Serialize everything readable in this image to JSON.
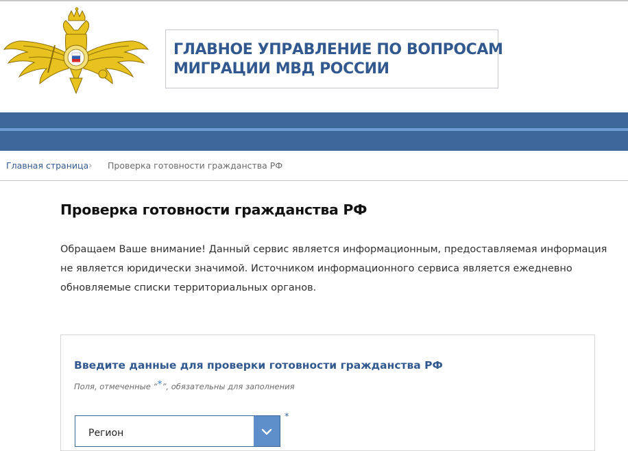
{
  "header": {
    "agency_title_line1": "ГЛАВНОЕ УПРАВЛЕНИЕ ПО ВОПРОСАМ",
    "agency_title_line2": "МИГРАЦИИ МВД РОССИИ"
  },
  "breadcrumb": {
    "home": "Главная страница",
    "separator": "›",
    "current": "Проверка готовности гражданства РФ"
  },
  "page": {
    "title": "Проверка готовности гражданства РФ",
    "notice_lines": [
      "Обращаем Ваше внимание! Данный сервис является информационным, предоставляемая информация",
      "не является юридически значимой. Источником информационного сервиса является ежедневно",
      "обновляемые списки территориальных органов."
    ]
  },
  "form": {
    "title": "Введите данные для проверки готовности гражданства РФ",
    "hint_before": "Поля, отмеченные “",
    "hint_star": "*",
    "hint_after": "”, обязательны для заполнения",
    "region_select": {
      "value": "Регион",
      "required_mark": "*"
    }
  },
  "colors": {
    "brand_blue": "#3d6699",
    "stripe_light_blue": "#6d9ed6",
    "title_blue": "#32598f",
    "select_button": "#5f8fcb"
  },
  "icons": {
    "emblem": "mvd-double-headed-eagle-emblem",
    "breadcrumb_separator": "chevron-right-icon",
    "select_toggle": "chevron-down-icon"
  }
}
